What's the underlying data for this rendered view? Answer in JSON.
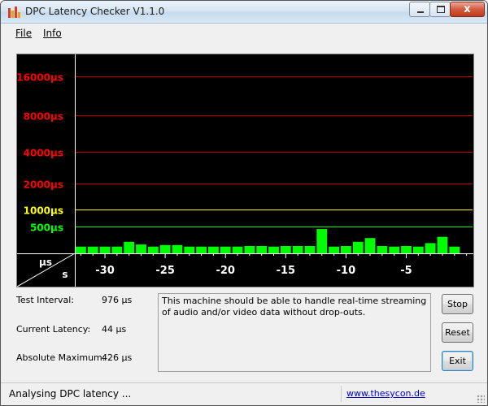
{
  "window": {
    "title": "DPC Latency Checker V1.1.0",
    "controls": {
      "minimize_icon": "minimize-icon",
      "maximize_icon": "maximize-icon",
      "close_glyph": "x"
    }
  },
  "menu": {
    "file_label": "File",
    "info_label": "Info"
  },
  "chart_data": {
    "type": "bar",
    "title": "",
    "ylabel": "µs",
    "xlabel": "s",
    "y_ticks": [
      {
        "label": "16000µs",
        "value": 16000,
        "color": "#ff0000"
      },
      {
        "label": "8000µs",
        "value": 8000,
        "color": "#ff0000"
      },
      {
        "label": "4000µs",
        "value": 4000,
        "color": "#ff0000"
      },
      {
        "label": "2000µs",
        "value": 2000,
        "color": "#ff0000"
      },
      {
        "label": "1000µs",
        "value": 1000,
        "color": "#ffff00"
      },
      {
        "label": "500µs",
        "value": 500,
        "color": "#00ff00"
      }
    ],
    "y_scale": "log",
    "ylim": [
      100,
      20000
    ],
    "x_ticks": [
      -30,
      -25,
      -20,
      -15,
      -10,
      -5
    ],
    "x_tick_labels": [
      "-30",
      "-25",
      "-20",
      "-15",
      "-10",
      "-5"
    ],
    "x_range": [
      -32,
      0
    ],
    "bar_color": "#00ff00",
    "background": "#000000",
    "series": [
      {
        "values": [
          {
            "x": -32,
            "y": 150
          },
          {
            "x": -31,
            "y": 150
          },
          {
            "x": -30,
            "y": 150
          },
          {
            "x": -29,
            "y": 150
          },
          {
            "x": -28,
            "y": 200
          },
          {
            "x": -27,
            "y": 170
          },
          {
            "x": -26,
            "y": 150
          },
          {
            "x": -25,
            "y": 165
          },
          {
            "x": -24,
            "y": 165
          },
          {
            "x": -23,
            "y": 150
          },
          {
            "x": -22,
            "y": 150
          },
          {
            "x": -21,
            "y": 150
          },
          {
            "x": -20,
            "y": 150
          },
          {
            "x": -19,
            "y": 150
          },
          {
            "x": -18,
            "y": 155
          },
          {
            "x": -17,
            "y": 155
          },
          {
            "x": -16,
            "y": 150
          },
          {
            "x": -15,
            "y": 155
          },
          {
            "x": -14,
            "y": 155
          },
          {
            "x": -13,
            "y": 155
          },
          {
            "x": -12,
            "y": 430
          },
          {
            "x": -11,
            "y": 150
          },
          {
            "x": -10,
            "y": 155
          },
          {
            "x": -9,
            "y": 200
          },
          {
            "x": -8,
            "y": 250
          },
          {
            "x": -7,
            "y": 155
          },
          {
            "x": -6,
            "y": 150
          },
          {
            "x": -5,
            "y": 155
          },
          {
            "x": -4,
            "y": 150
          },
          {
            "x": -3,
            "y": 185
          },
          {
            "x": -2,
            "y": 270
          },
          {
            "x": -1,
            "y": 150
          }
        ]
      }
    ]
  },
  "stats": {
    "test_interval": {
      "label": "Test Interval:",
      "value": "976 µs"
    },
    "current_latency": {
      "label": "Current Latency:",
      "value": "44 µs"
    },
    "absolute_maximum": {
      "label": "Absolute Maximum:",
      "value": "426 µs"
    }
  },
  "message": "This machine should be able to handle real-time streaming of audio and/or video data without drop-outs.",
  "buttons": {
    "stop": "Stop",
    "reset": "Reset",
    "exit": "Exit"
  },
  "status": {
    "text": "Analysing DPC latency ...",
    "link": "www.thesycon.de"
  }
}
